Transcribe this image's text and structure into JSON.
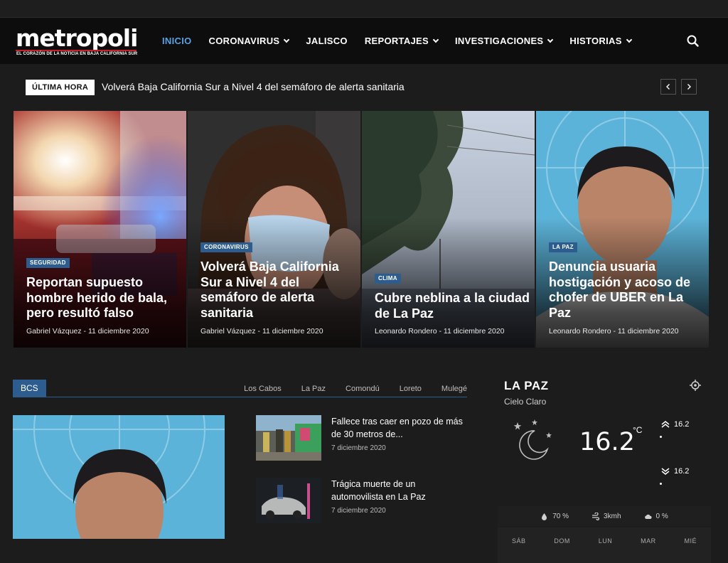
{
  "brand": {
    "name": "metropoli",
    "tagline": "EL CORAZÓN DE LA NOTICIA EN BAJA CALIFORNIA SUR"
  },
  "nav": {
    "items": [
      {
        "label": "INICIO",
        "active": true,
        "has_menu": false
      },
      {
        "label": "CORONAVIRUS",
        "active": false,
        "has_menu": true
      },
      {
        "label": "JALISCO",
        "active": false,
        "has_menu": false
      },
      {
        "label": "REPORTAJES",
        "active": false,
        "has_menu": true
      },
      {
        "label": "INVESTIGACIONES",
        "active": false,
        "has_menu": true
      },
      {
        "label": "HISTORIAS",
        "active": false,
        "has_menu": true
      }
    ],
    "search_icon": "search-icon"
  },
  "breaking": {
    "label": "ÚLTIMA HORA",
    "headline": "Volverá Baja California Sur a Nivel 4 del semáforo de alerta sanitaria"
  },
  "hero": [
    {
      "category": "SEGURIDAD",
      "title": "Reportan supuesto hombre herido de bala, pero resultó falso",
      "author": "Gabriel Vázquez",
      "date": "11 diciembre 2020",
      "meta": "Gabriel Vázquez - 11 diciembre 2020"
    },
    {
      "category": "CORONAVIRUS",
      "title": "Volverá Baja California Sur a Nivel 4 del semáforo de alerta sanitaria",
      "author": "Gabriel Vázquez",
      "date": "11 diciembre 2020",
      "meta": "Gabriel Vázquez - 11 diciembre 2020"
    },
    {
      "category": "CLIMA",
      "title": "Cubre neblina a la ciudad de La Paz",
      "author": "Leonardo Rondero",
      "date": "11 diciembre 2020",
      "meta": "Leonardo Rondero - 11 diciembre 2020"
    },
    {
      "category": "LA PAZ",
      "title": "Denuncia usuaria hostigación y acoso de chofer de UBER en La Paz",
      "author": "Leonardo Rondero",
      "date": "11 diciembre 2020",
      "meta": "Leonardo Rondero - 11 diciembre 2020"
    }
  ],
  "section": {
    "label": "BCS",
    "tabs": [
      "Los Cabos",
      "La Paz",
      "Comondú",
      "Loreto",
      "Mulegé"
    ]
  },
  "news": [
    {
      "title": "Fallece tras caer en pozo de más de 30 metros de...",
      "date": "7 diciembre 2020"
    },
    {
      "title": "Trágica muerte de un automovilista en La Paz",
      "date": "7 diciembre 2020"
    }
  ],
  "weather": {
    "city": "LA PAZ",
    "condition": "Cielo Claro",
    "temp": "16.2",
    "unit": "°C",
    "high": "16.2",
    "low": "16.2",
    "humidity": "70 %",
    "wind": "3kmh",
    "clouds": "0 %",
    "days": [
      "SÁB",
      "DOM",
      "LUN",
      "MAR",
      "MIÉ"
    ]
  },
  "colors": {
    "accent": "#2c5d8e",
    "active_nav": "#5aa0e0",
    "brand_red": "#c8202a",
    "background": "#1c1c1c"
  }
}
